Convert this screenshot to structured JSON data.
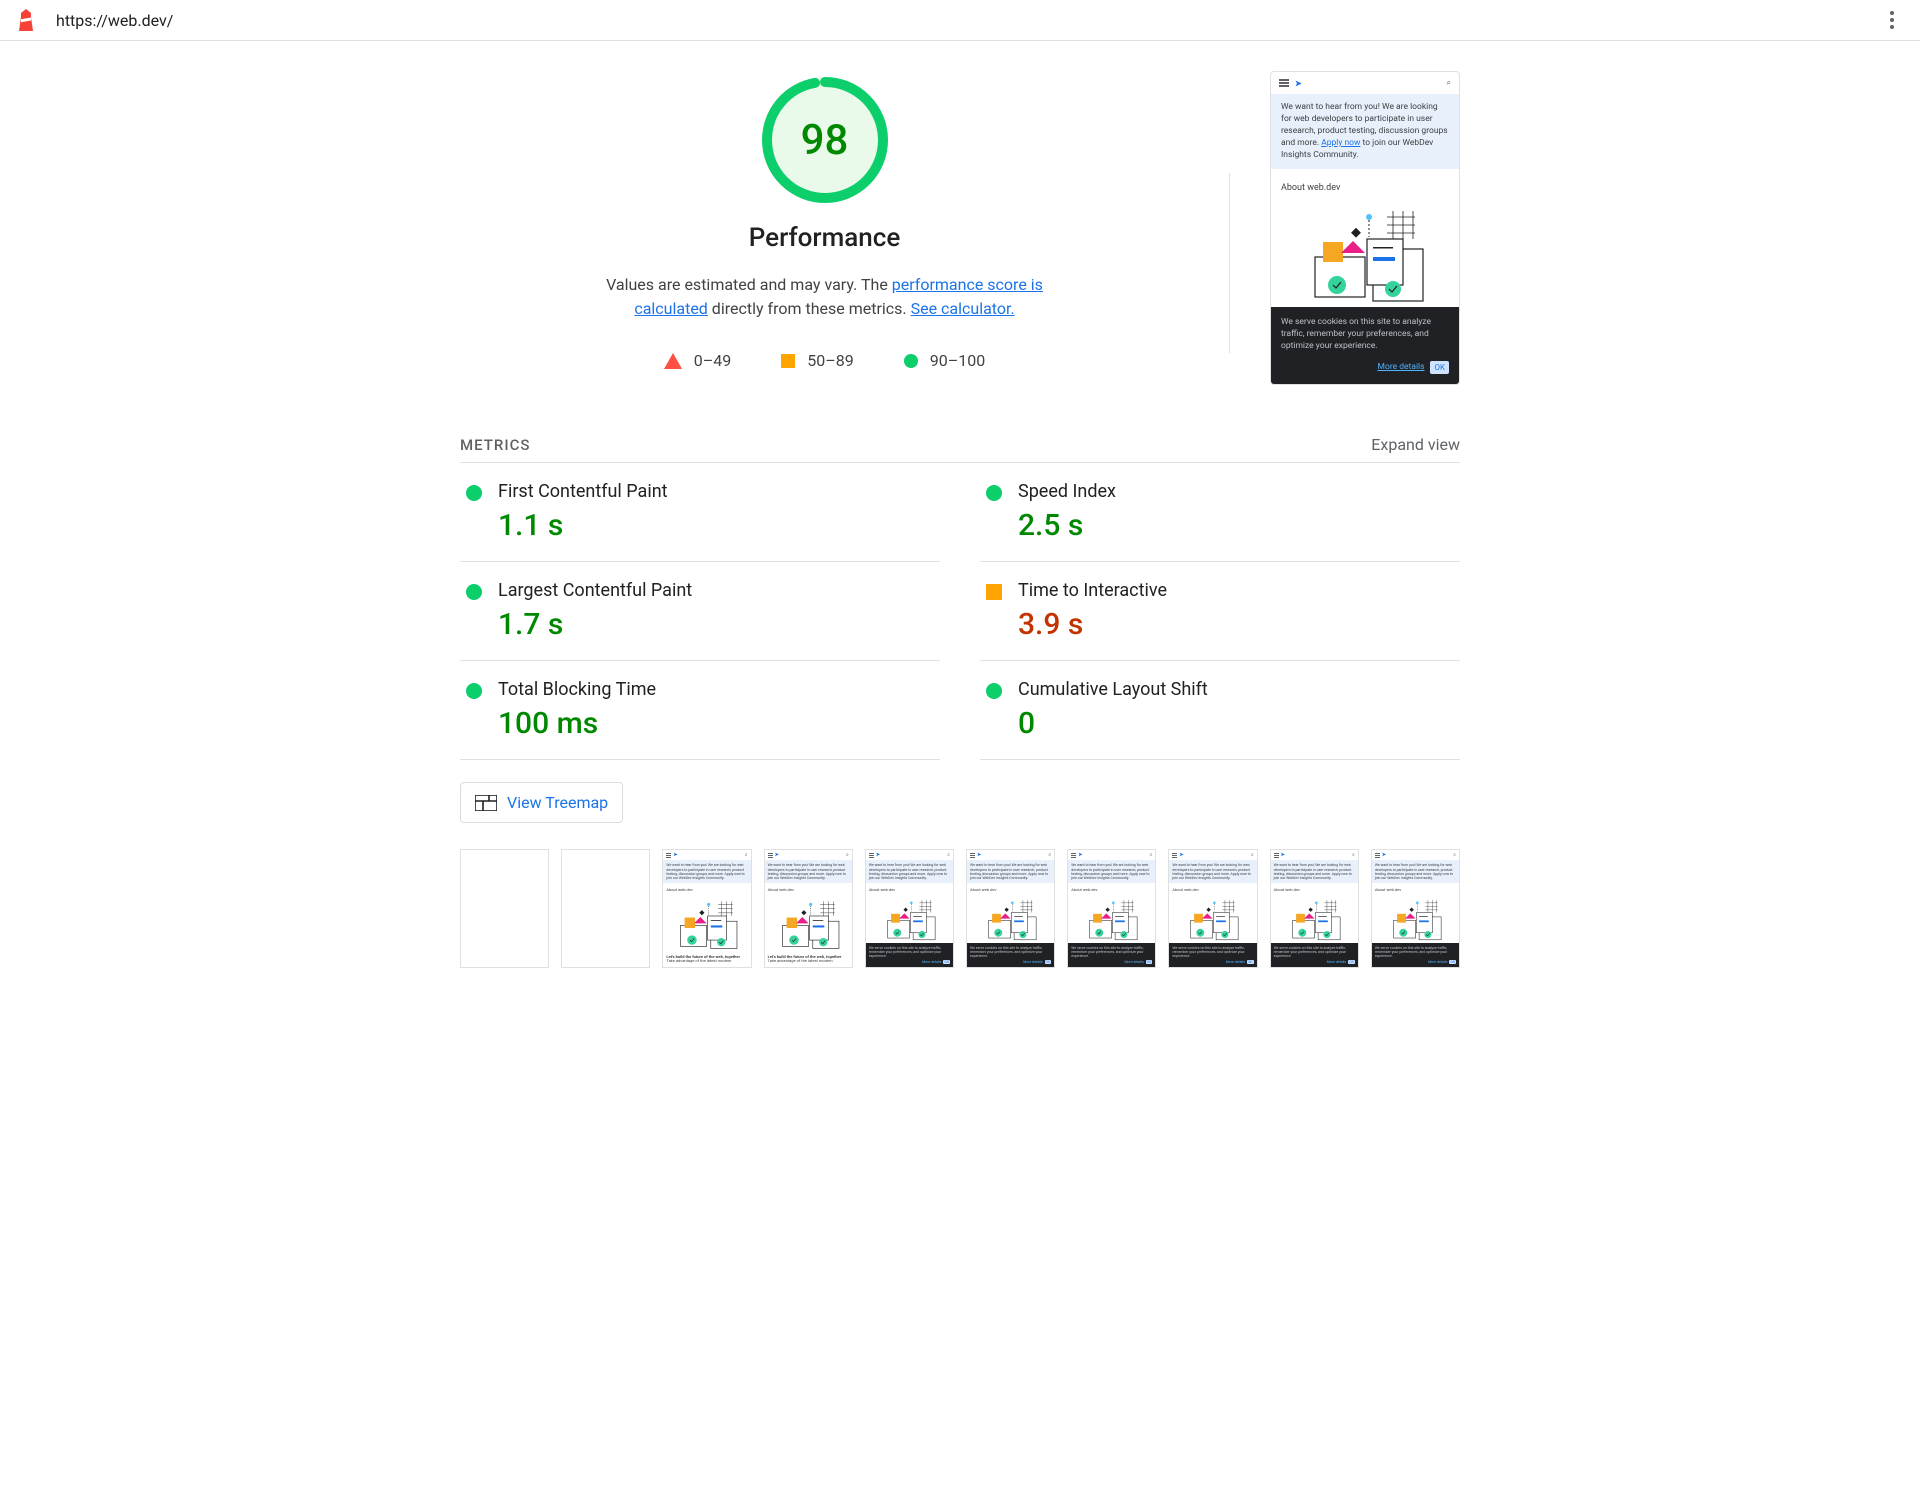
{
  "url": "https://web.dev/",
  "gauge": {
    "score": "98",
    "title": "Performance"
  },
  "description": {
    "pre": "Values are estimated and may vary. The ",
    "link1": "performance score is calculated",
    "mid": " directly from these metrics. ",
    "link2": "See calculator."
  },
  "legend": {
    "low": "0–49",
    "mid": "50–89",
    "high": "90–100"
  },
  "preview": {
    "banner_pre": "We want to hear from you! We are looking for web developers to participate in user research, product testing, discussion groups and more. ",
    "banner_link": "Apply now",
    "banner_post": " to join our WebDev Insights Community.",
    "about": "About web.dev",
    "footer": "We serve cookies on this site to analyze traffic, remember your preferences, and optimize your experience.",
    "more": "More details",
    "ok": "OK"
  },
  "metrics_header": "METRICS",
  "expand": "Expand view",
  "metrics": [
    {
      "title": "First Contentful Paint",
      "value": "1.1 s",
      "status": "green"
    },
    {
      "title": "Speed Index",
      "value": "2.5 s",
      "status": "green"
    },
    {
      "title": "Largest Contentful Paint",
      "value": "1.7 s",
      "status": "green"
    },
    {
      "title": "Time to Interactive",
      "value": "3.9 s",
      "status": "orange"
    },
    {
      "title": "Total Blocking Time",
      "value": "100 ms",
      "status": "green"
    },
    {
      "title": "Cumulative Layout Shift",
      "value": "0",
      "status": "green"
    }
  ],
  "treemap": "View Treemap",
  "filmstrip": {
    "caption_build": "Let's build the future of the web, together",
    "subcaption": "Take advantage of the latest modern"
  }
}
